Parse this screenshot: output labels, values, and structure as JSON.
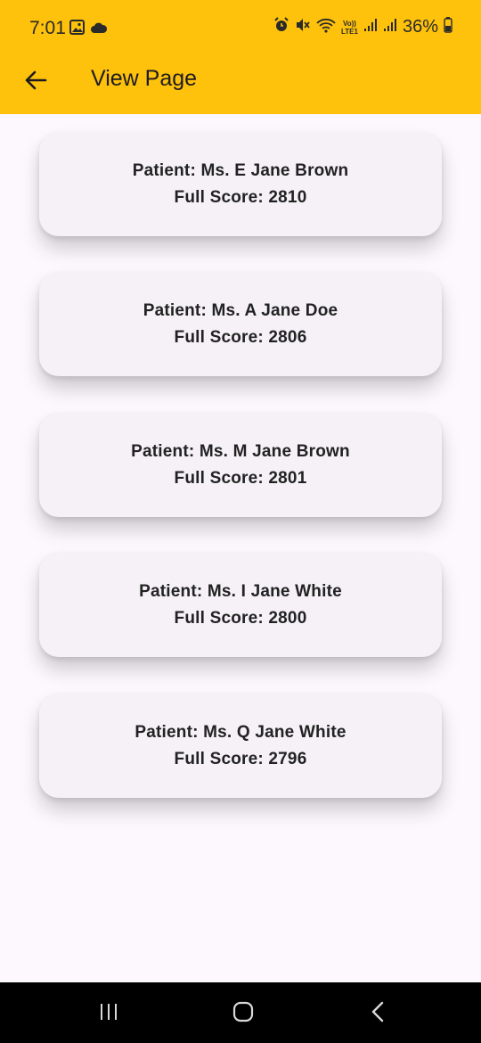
{
  "status_bar": {
    "time": "7:01",
    "battery": "36%",
    "icons_left": [
      "image-icon",
      "cloud-icon"
    ],
    "icons_right": [
      "alarm-icon",
      "mute-icon",
      "wifi-icon",
      "volte-icon",
      "signal-icon",
      "signal-icon-2",
      "battery-icon"
    ],
    "volte_label_top": "Vo))",
    "volte_label_bottom": "LTE1"
  },
  "app_bar": {
    "title": "View Page",
    "back_icon": "arrow-left-icon",
    "background": "#fec20c"
  },
  "patients": [
    {
      "patient": "Patient: Ms. E Jane Brown",
      "score": "Full Score: 2810"
    },
    {
      "patient": "Patient: Ms. A Jane Doe",
      "score": "Full Score: 2806"
    },
    {
      "patient": "Patient: Ms. M Jane Brown",
      "score": "Full Score: 2801"
    },
    {
      "patient": "Patient: Ms. I Jane White",
      "score": "Full Score: 2800"
    },
    {
      "patient": "Patient: Ms. Q Jane White",
      "score": "Full Score: 2796"
    }
  ],
  "nav_bar": {
    "buttons": [
      "recent-apps-icon",
      "home-icon",
      "back-icon"
    ]
  }
}
